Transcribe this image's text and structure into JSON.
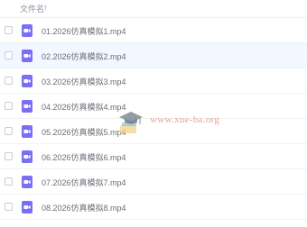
{
  "header": {
    "column_label": "文件名",
    "sort_icon": "arrow-up-icon",
    "accent_color": "#3b86f5"
  },
  "files": [
    {
      "name": "01.2026仿真模拟1.mp4",
      "icon": "video-file-icon"
    },
    {
      "name": "02.2026仿真模拟2.mp4",
      "icon": "video-file-icon"
    },
    {
      "name": "03.2026仿真模拟3.mp4",
      "icon": "video-file-icon"
    },
    {
      "name": "04.2026仿真模拟4.mp4",
      "icon": "video-file-icon"
    },
    {
      "name": "05.2026仿真模拟5.mp4",
      "icon": "video-file-icon"
    },
    {
      "name": "06.2026仿真模拟6.mp4",
      "icon": "video-file-icon"
    },
    {
      "name": "07.2026仿真模拟7.mp4",
      "icon": "video-file-icon"
    },
    {
      "name": "08.2026仿真模拟8.mp4",
      "icon": "video-file-icon"
    }
  ],
  "watermark": {
    "text": "www.xue-ba.org",
    "logo": "graduation-cap-logo"
  },
  "colors": {
    "file_icon": "#7b6ef6",
    "hover_row": "#f2f8ff",
    "watermark_text": "#e8a39a"
  }
}
